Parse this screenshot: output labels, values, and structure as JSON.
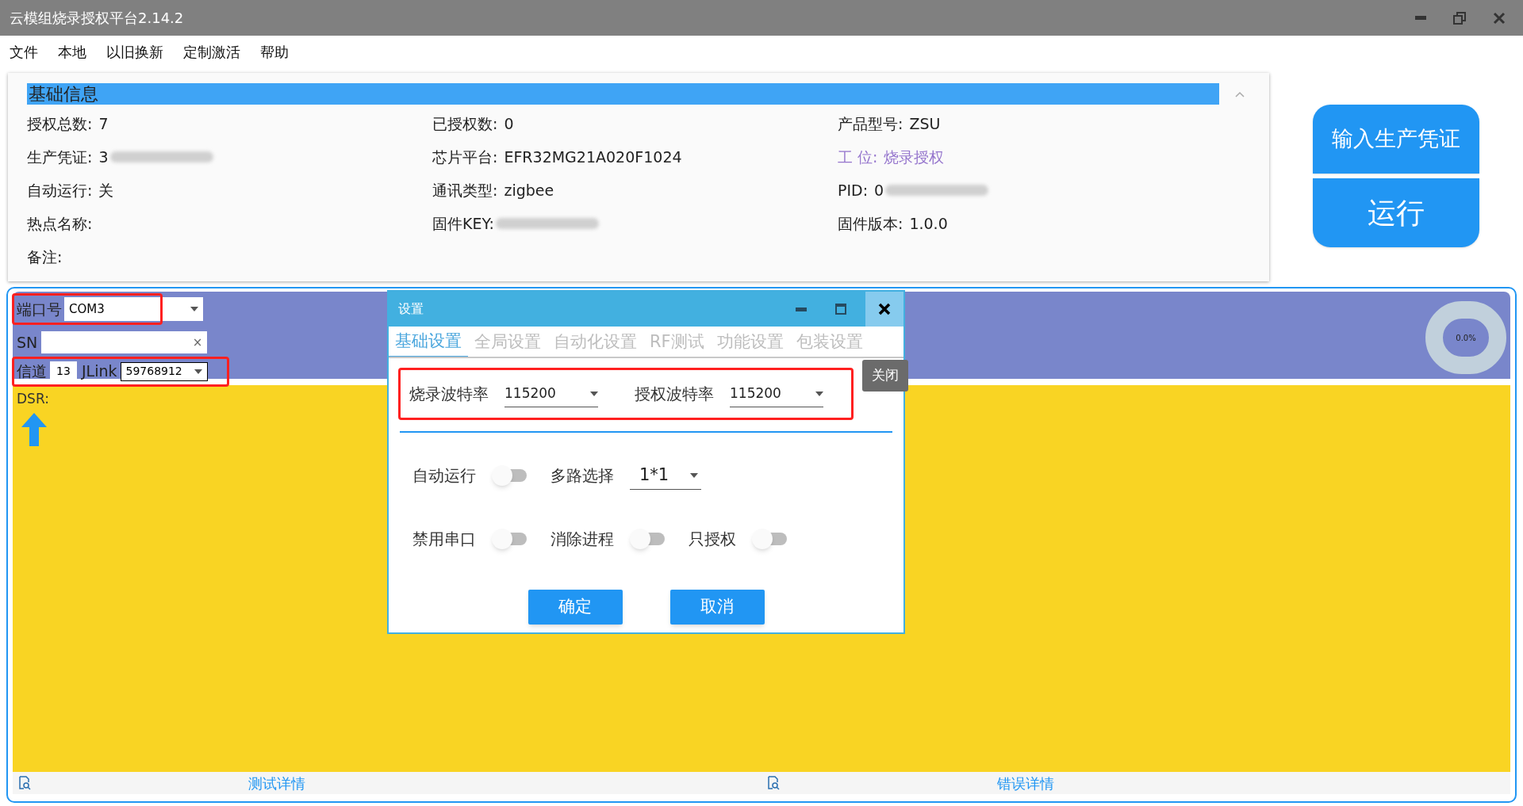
{
  "window": {
    "title": "云模组烧录授权平台2.14.2"
  },
  "menu": [
    "文件",
    "本地",
    "以旧换新",
    "定制激活",
    "帮助"
  ],
  "info_panel": {
    "title": "基础信息",
    "expanded": true,
    "fields": [
      {
        "label": "授权总数:",
        "value": "7",
        "kind": "text"
      },
      {
        "label": "已授权数:",
        "value": "0",
        "kind": "text"
      },
      {
        "label": "产品型号:",
        "value": "ZSU",
        "kind": "text"
      },
      {
        "label": "生产凭证:",
        "value": "3",
        "kind": "redacted"
      },
      {
        "label": "芯片平台:",
        "value": "EFR32MG21A020F1024",
        "kind": "text"
      },
      {
        "label": "工 位:",
        "value": "烧录授权",
        "kind": "highlight"
      },
      {
        "label": "自动运行:",
        "value": "关",
        "kind": "text"
      },
      {
        "label": "通讯类型:",
        "value": "zigbee",
        "kind": "text"
      },
      {
        "label": "PID:",
        "value": "0",
        "kind": "redacted"
      },
      {
        "label": "热点名称:",
        "kind": "text"
      },
      {
        "label": "固件KEY:",
        "kind": "redacted"
      },
      {
        "label": "固件版本:",
        "value": "1.0.0",
        "kind": "text"
      },
      {
        "label": "备注:",
        "kind": "text"
      }
    ]
  },
  "action_buttons": [
    "输入生产凭证",
    "运行"
  ],
  "port_panel": {
    "port": {
      "label": "端口号",
      "value": "COM3",
      "highlighted": true
    },
    "sn": {
      "label": "SN",
      "clear": "×"
    },
    "channel": {
      "label": "信道",
      "value": "13",
      "jlink_label": "JLink",
      "jlink_value": "59768912",
      "highlighted": true
    },
    "progress": "0.0%"
  },
  "work_area": {
    "dsr_label": "DSR:"
  },
  "footer": [
    "测试详情",
    "错误详情"
  ],
  "dialog": {
    "title": "设置",
    "tabs": [
      {
        "label": "基础设置",
        "selected": true
      },
      {
        "label": "全局设置",
        "selected": false
      },
      {
        "label": "自动化设置",
        "selected": false
      },
      {
        "label": "RF测试",
        "selected": false
      },
      {
        "label": "功能设置",
        "selected": false
      },
      {
        "label": "包装设置",
        "selected": false
      }
    ],
    "tooltip": "关闭",
    "baud_group": {
      "highlighted": true,
      "items": [
        {
          "label": "烧录波特率",
          "value": "115200"
        },
        {
          "label": "授权波特率",
          "value": "115200"
        }
      ]
    },
    "rows": [
      [
        {
          "kind": "toggle",
          "label": "自动运行",
          "on": false
        },
        {
          "kind": "select",
          "label": "多路选择",
          "value": "1*1"
        }
      ],
      [
        {
          "kind": "toggle",
          "label": "禁用串口",
          "on": false
        },
        {
          "kind": "toggle",
          "label": "消除进程",
          "on": false
        },
        {
          "kind": "toggle",
          "label": "只授权",
          "on": false
        }
      ]
    ],
    "buttons": [
      "确定",
      "取消"
    ]
  }
}
